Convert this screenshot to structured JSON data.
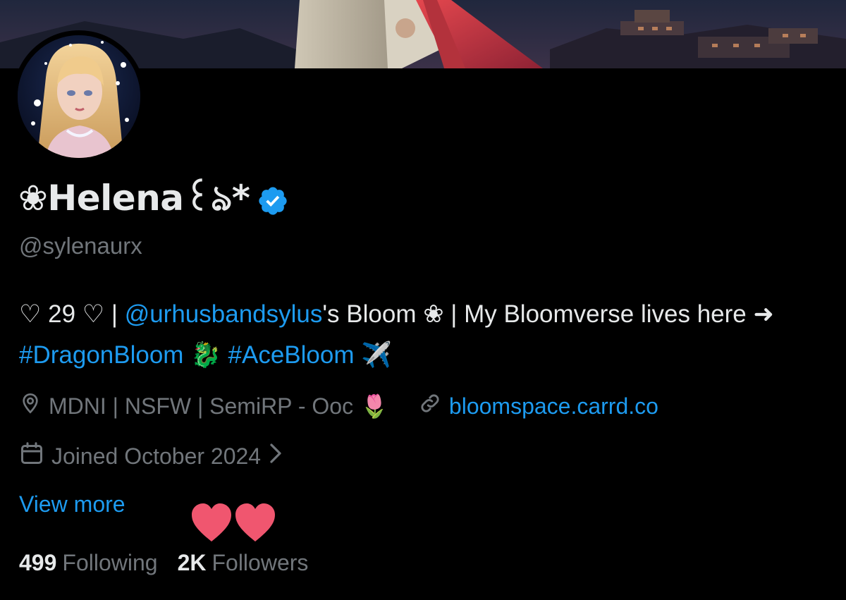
{
  "profile": {
    "display_name": "❀Helena꒰ঌ*",
    "handle": "@sylenaurx",
    "verified": true
  },
  "bio": {
    "part1": "♡ 29 ♡ | ",
    "mention": "@urhusbandsylus",
    "part2": "'s Bloom ❀ | My Bloomverse lives here ➜ ",
    "hashtag1": "#DragonBloom",
    "emoji1": "🐉",
    "hashtag2": "#AceBloom",
    "emoji2": "✈️"
  },
  "meta": {
    "location": "MDNI | NSFW | SemiRP - Ooc",
    "location_emoji": "🌷",
    "website": "bloomspace.carrd.co",
    "joined": "Joined October 2024"
  },
  "actions": {
    "view_more": "View more"
  },
  "stats": {
    "following_count": "499",
    "following_label": "Following",
    "followers_count": "2K",
    "followers_label": "Followers"
  },
  "icons": {
    "location": "location-pin-icon",
    "website": "link-icon",
    "joined": "calendar-icon",
    "verified": "verified-badge-icon"
  },
  "colors": {
    "background": "#000000",
    "text_primary": "#e7e9ea",
    "text_secondary": "#71767b",
    "link": "#1d9bf0",
    "verified": "#1d9bf0",
    "heart": "#f0566f"
  }
}
